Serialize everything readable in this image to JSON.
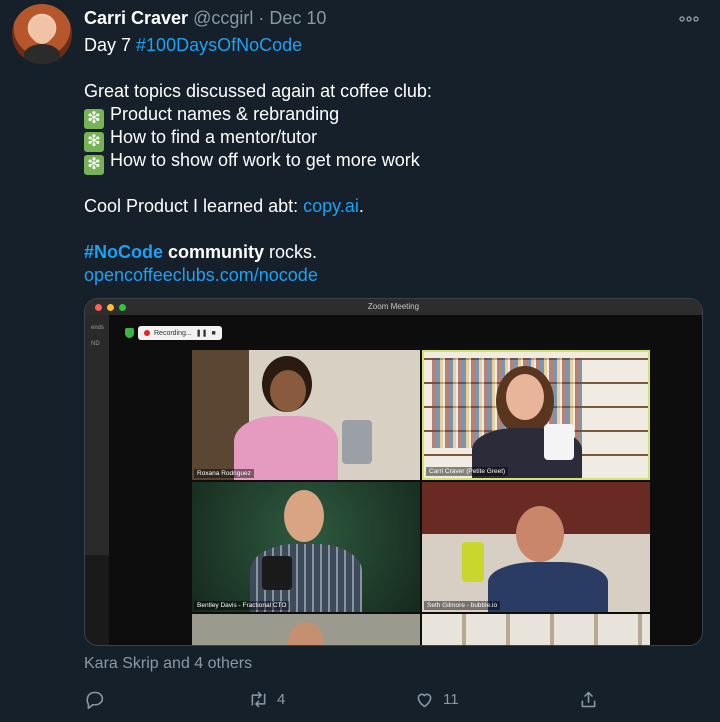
{
  "tweet": {
    "author_name": "Carri Craver",
    "handle": "@ccgirl",
    "separator": "·",
    "date": "Dec 10",
    "more_icon": "more-icon",
    "lines": {
      "l1_a": "Day 7 ",
      "l1_tag": "#100DaysOfNoCode",
      "l3": "Great topics discussed again at coffee club:",
      "bullet_icon": "❇",
      "b1": "Product names & rebranding",
      "b2": "How to find a mentor/tutor",
      "b3": "How to show off work to get more work",
      "l8_a": "Cool Product I learned abt: ",
      "l8_link": "copy.ai",
      "l8_end": ".",
      "l10_tag": "#NoCode",
      "l10_bold": " community",
      "l10_end": " rocks.",
      "l11_link": "opencoffeeclubs.com/nocode"
    },
    "media": {
      "window_title": "Zoom Meeting",
      "recording_label": "Recording...",
      "sidebar_texts": [
        "ends",
        "ND"
      ],
      "participants": [
        "Roxana Rodriguez",
        "Carri Craver (Petite Greet)",
        "Bentley Davis - Fractional CTO",
        "Seth Gilmore - bubble.io"
      ]
    },
    "liked_by": "Kara Skrip and 4 others",
    "actions": {
      "reply_count": "",
      "retweet_count": "4",
      "like_count": "11"
    }
  },
  "colors": {
    "background": "#15202b",
    "link": "#1da1f2",
    "muted": "#8899a6",
    "active_speaker_border": "#d6e36a"
  }
}
